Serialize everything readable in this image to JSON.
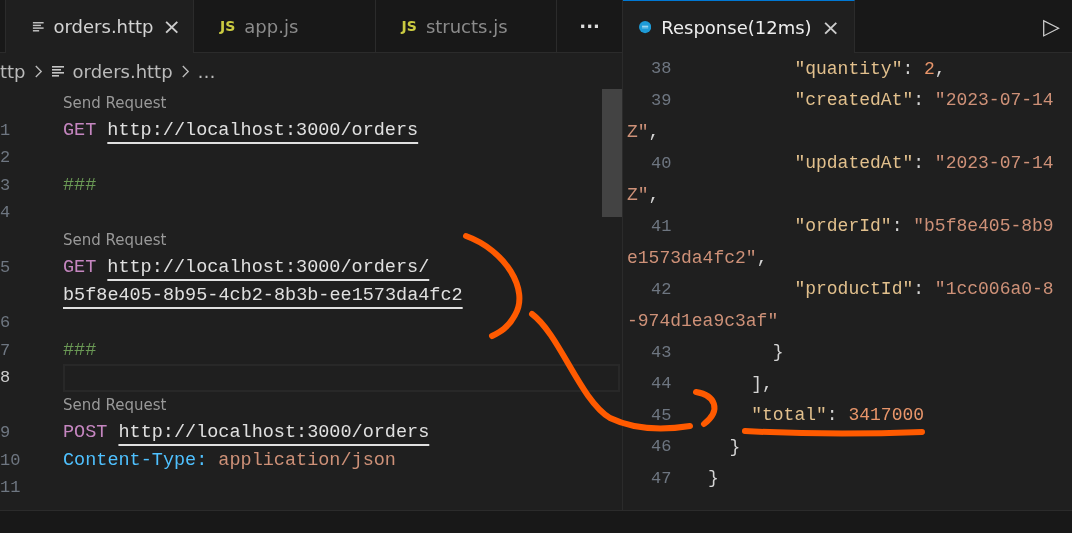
{
  "editor_tabs": [
    {
      "kind": "file",
      "label": "orders.http",
      "close": "×",
      "selected": true
    },
    {
      "kind": "js",
      "badge": "JS",
      "label": "app.js",
      "selected": false
    },
    {
      "kind": "js",
      "badge": "JS",
      "label": "structs.js",
      "selected": false
    }
  ],
  "overflow_button": "···",
  "breadcrumb": [
    "ttp",
    "orders.http",
    "…"
  ],
  "request_lines": [
    {
      "number": "1",
      "lens": "Send Request",
      "current": false,
      "tokens": [
        {
          "kind": "method",
          "text": "GET"
        },
        {
          "kind": "url",
          "text": "http://localhost:3000/orders"
        }
      ]
    },
    {
      "number": "2",
      "current": false
    },
    {
      "number": "3",
      "current": false,
      "tokens": [
        {
          "kind": "comment",
          "text": "###"
        }
      ]
    },
    {
      "number": "4",
      "current": false
    },
    {
      "number": "5",
      "lens": "Send Request",
      "current": false,
      "tokens": [
        {
          "kind": "method",
          "text": "GET"
        },
        {
          "kind": "url",
          "text": "http://localhost:3000/orders/"
        }
      ],
      "wrap": [
        {
          "kind": "url",
          "text": "b5f8e405-8b95-4cb2-8b3b-ee1573da4fc2"
        }
      ]
    },
    {
      "number": "6",
      "current": false
    },
    {
      "number": "7",
      "current": false,
      "tokens": [
        {
          "kind": "comment",
          "text": "###"
        }
      ]
    },
    {
      "number": "8",
      "current": true
    },
    {
      "number": "9",
      "lens": "Send Request",
      "current": false,
      "tokens": [
        {
          "kind": "method",
          "text": "POST"
        },
        {
          "kind": "url",
          "text": "http://localhost:3000/orders"
        }
      ]
    },
    {
      "number": "10",
      "current": false,
      "tokens": [
        {
          "kind": "header",
          "text": "Content-Type:"
        },
        {
          "kind": "value",
          "text": "application/json"
        }
      ]
    },
    {
      "number": "11",
      "current": false
    }
  ],
  "response_tab": {
    "label": "Response(12ms)",
    "close": "×",
    "selected": true
  },
  "run_button": "▷",
  "response_lines": [
    {
      "number": "38",
      "tokens": [
        {
          "kind": "key",
          "text": "        \"quantity\""
        },
        {
          "kind": "punct",
          "text": ": "
        },
        {
          "kind": "number",
          "text": "2"
        },
        {
          "kind": "punct",
          "text": ","
        }
      ]
    },
    {
      "number": "39",
      "tokens": [
        {
          "kind": "key",
          "text": "        \"createdAt\""
        },
        {
          "kind": "punct",
          "text": ": "
        },
        {
          "kind": "string",
          "text": "\"2023-07-14"
        }
      ],
      "wrap": [
        {
          "kind": "string",
          "text": "Z\""
        },
        {
          "kind": "punct",
          "text": ","
        }
      ]
    },
    {
      "number": "40",
      "tokens": [
        {
          "kind": "key",
          "text": "        \"updatedAt\""
        },
        {
          "kind": "punct",
          "text": ": "
        },
        {
          "kind": "string",
          "text": "\"2023-07-14"
        }
      ],
      "wrap": [
        {
          "kind": "string",
          "text": "Z\""
        },
        {
          "kind": "punct",
          "text": ","
        }
      ]
    },
    {
      "number": "41",
      "tokens": [
        {
          "kind": "key",
          "text": "        \"orderId\""
        },
        {
          "kind": "punct",
          "text": ": "
        },
        {
          "kind": "string",
          "text": "\"b5f8e405-8b9"
        }
      ],
      "wrap": [
        {
          "kind": "string",
          "text": "e1573da4fc2\""
        },
        {
          "kind": "punct",
          "text": ","
        }
      ]
    },
    {
      "number": "42",
      "tokens": [
        {
          "kind": "key",
          "text": "        \"productId\""
        },
        {
          "kind": "punct",
          "text": ": "
        },
        {
          "kind": "string",
          "text": "\"1cc006a0-8"
        }
      ],
      "wrap": [
        {
          "kind": "string",
          "text": "-974d1ea9c3af\""
        }
      ]
    },
    {
      "number": "43",
      "tokens": [
        {
          "kind": "punct",
          "text": "      }"
        }
      ]
    },
    {
      "number": "44",
      "tokens": [
        {
          "kind": "punct",
          "text": "    ],"
        }
      ]
    },
    {
      "number": "45",
      "tokens": [
        {
          "kind": "key",
          "text": "    \"total\""
        },
        {
          "kind": "punct",
          "text": ": "
        },
        {
          "kind": "number",
          "text": "3417000"
        }
      ]
    },
    {
      "number": "46",
      "tokens": [
        {
          "kind": "punct",
          "text": "  }"
        }
      ]
    },
    {
      "number": "47",
      "tokens": [
        {
          "kind": "punct",
          "text": "}"
        }
      ]
    }
  ]
}
